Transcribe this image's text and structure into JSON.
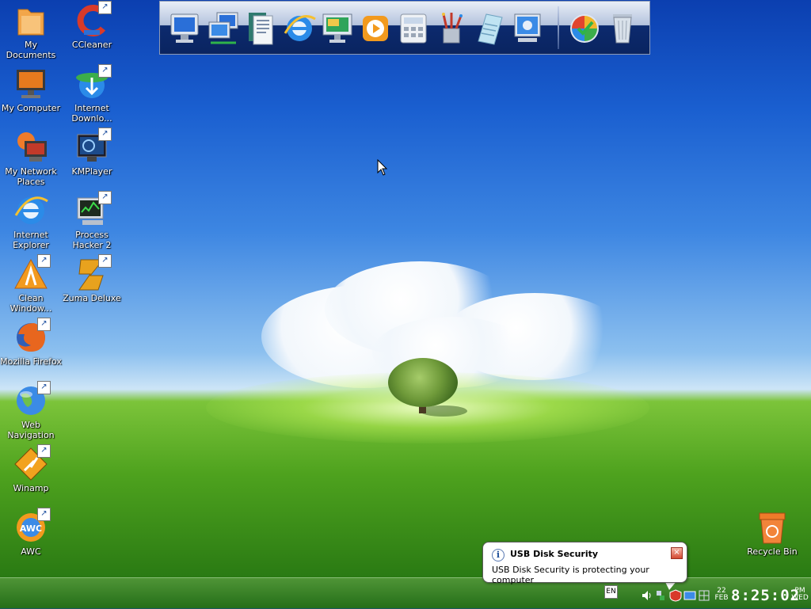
{
  "desktop": {
    "icons_left": [
      {
        "label": "My Documents",
        "icon": "folder-icon",
        "shortcut": false
      },
      {
        "label": "My Computer",
        "icon": "computer-icon",
        "shortcut": false
      },
      {
        "label": "My Network Places",
        "icon": "network-places-icon",
        "shortcut": false
      },
      {
        "label": "Internet Explorer",
        "icon": "internet-explorer-icon",
        "shortcut": false
      },
      {
        "label": "Clean Window...",
        "icon": "clean-windows-icon",
        "shortcut": true
      },
      {
        "label": "Mozilla Firefox",
        "icon": "firefox-icon",
        "shortcut": true
      },
      {
        "label": "Web Navigation",
        "icon": "web-navigation-icon",
        "shortcut": true
      },
      {
        "label": "Winamp",
        "icon": "winamp-icon",
        "shortcut": true
      },
      {
        "label": "AWC",
        "icon": "awc-icon",
        "shortcut": true
      }
    ],
    "icons_right_col": [
      {
        "label": "CCleaner",
        "icon": "ccleaner-icon",
        "shortcut": true
      },
      {
        "label": "Internet Downlo...",
        "icon": "internet-download-manager-icon",
        "shortcut": true
      },
      {
        "label": "KMPlayer",
        "icon": "kmplayer-icon",
        "shortcut": true
      },
      {
        "label": "Process Hacker 2",
        "icon": "process-hacker-icon",
        "shortcut": true
      },
      {
        "label": "Zuma Deluxe",
        "icon": "zuma-icon",
        "shortcut": true
      }
    ],
    "recycle_bin": {
      "label": "Recycle Bin",
      "icon": "recycle-bin-icon"
    }
  },
  "dock": {
    "items": [
      {
        "icon": "desktop-monitor-icon"
      },
      {
        "icon": "network-computers-icon"
      },
      {
        "icon": "documents-icon"
      },
      {
        "icon": "internet-explorer-icon"
      },
      {
        "icon": "presentation-monitor-icon"
      },
      {
        "icon": "media-player-icon"
      },
      {
        "icon": "calculator-icon"
      },
      {
        "icon": "paint-brushes-icon"
      },
      {
        "icon": "notepad-icon"
      },
      {
        "icon": "control-panel-icon"
      },
      {
        "icon": "windows-logo-icon"
      },
      {
        "icon": "recycle-bin-icon"
      }
    ]
  },
  "taskbar": {
    "language": "EN",
    "clock": {
      "day": "22",
      "month": "FEB",
      "time": "8:25:02",
      "ampm": "PM",
      "weekday": "WED"
    },
    "tray_icons": [
      "volume-icon",
      "network-icon",
      "usb-disk-security-icon",
      "display-icon",
      "grid-icon"
    ]
  },
  "notification": {
    "title": "USB Disk Security",
    "message": "USB Disk Security is protecting your computer",
    "info_glyph": "i",
    "close_glyph": "×"
  },
  "colors": {
    "sky_top": "#0b3fb0",
    "grass": "#4ea21e",
    "balloon_bg": "#ffffff"
  }
}
